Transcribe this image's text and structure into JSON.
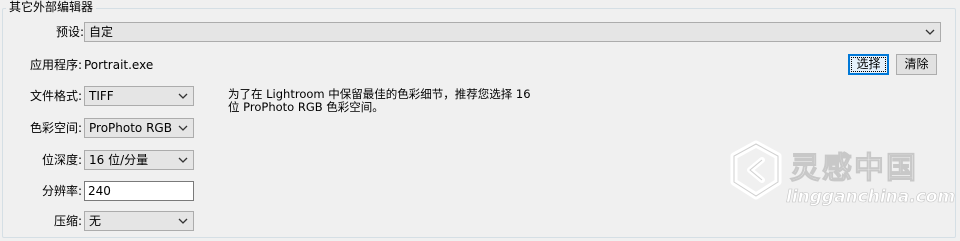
{
  "group": {
    "title": "其它外部编辑器"
  },
  "preset": {
    "label": "预设:",
    "value": "自定"
  },
  "application": {
    "label": "应用程序:",
    "value": "Portrait.exe",
    "choose_button": "选择",
    "clear_button": "清除"
  },
  "file_format": {
    "label": "文件格式:",
    "value": "TIFF"
  },
  "color_space": {
    "label": "色彩空间:",
    "value": "ProPhoto RGB"
  },
  "bit_depth": {
    "label": "位深度:",
    "value": "16 位/分量"
  },
  "resolution": {
    "label": "分辨率:",
    "value": "240"
  },
  "compression": {
    "label": "压缩:",
    "value": "无"
  },
  "info": {
    "line1": "为了在 Lightroom 中保留最佳的色彩细节，推荐您选择 16",
    "line2": "位 ProPhoto RGB 色彩空间。"
  },
  "watermark": {
    "title": "灵感中国",
    "subtitle": "lingganchina.com"
  },
  "icons": {
    "dropdown": "chevron-down-icon",
    "watermark_logo": "lingganchina-logo"
  },
  "colors": {
    "background": "#f0f0f0",
    "focus_blue": "#0078d7",
    "combo_bg": "#e5e5e5"
  }
}
